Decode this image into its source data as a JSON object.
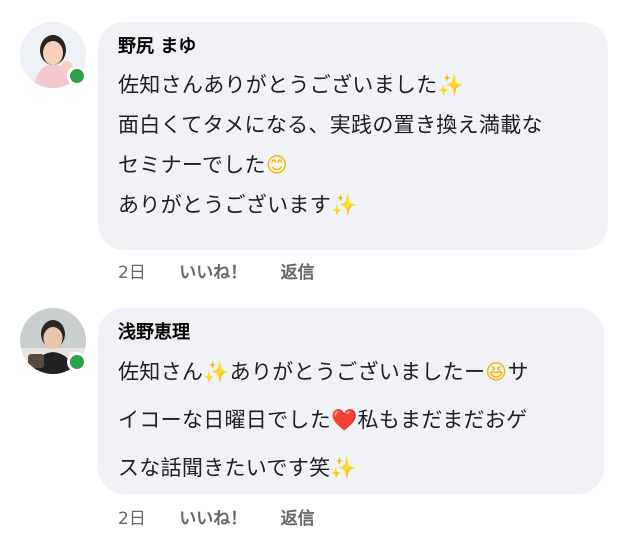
{
  "comments": [
    {
      "author": "野尻 まゆ",
      "lines": [
        {
          "text": "佐知さんありがとうございました",
          "emoji": "✨",
          "emoji_name": "sparkles-emoji"
        },
        {
          "text": "面白くてタメになる、実践の置き換え満載な",
          "emoji": "",
          "emoji_name": ""
        },
        {
          "text": "セミナーでした",
          "emoji": "😊",
          "emoji_name": "smiling-face-emoji"
        },
        {
          "text": "ありがとうございます",
          "emoji": "✨",
          "emoji_name": "sparkles-emoji"
        }
      ],
      "time": "2日",
      "like_label": "いいね！",
      "reply_label": "返信",
      "online": true
    },
    {
      "author": "浅野恵理",
      "lines": [
        {
          "pre": "佐知さん",
          "emoji1": "✨",
          "mid": "ありがとうございましたー",
          "emoji2": "😆",
          "post": "サ"
        },
        {
          "pre": "イコーな日曜日でした",
          "emoji1": "❤️",
          "mid": "私もまだまだおゲ",
          "emoji2": "",
          "post": ""
        },
        {
          "pre": "スな話聞きたいです笑",
          "emoji1": "✨",
          "mid": "",
          "emoji2": "",
          "post": ""
        }
      ],
      "time": "2日",
      "like_label": "いいね！",
      "reply_label": "返信",
      "online": true
    }
  ],
  "colors": {
    "bubble": "#f0f2f5",
    "online": "#31a24c",
    "meta_text": "#65676b"
  }
}
